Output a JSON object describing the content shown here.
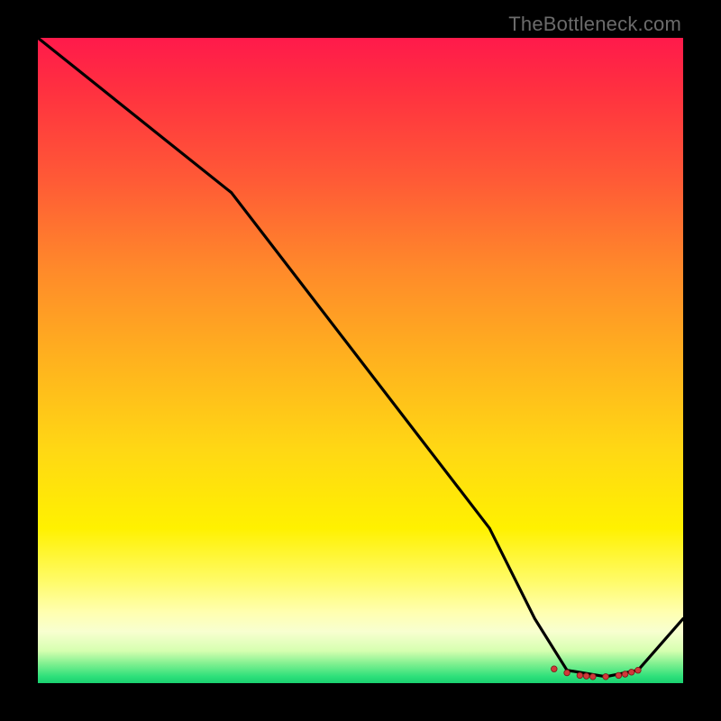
{
  "watermark": "TheBottleneck.com",
  "chart_data": {
    "type": "line",
    "title": "",
    "xlabel": "",
    "ylabel": "",
    "xlim": [
      0,
      100
    ],
    "ylim": [
      0,
      100
    ],
    "grid": false,
    "legend": false,
    "series": [
      {
        "name": "curve",
        "x": [
          0,
          10,
          20,
          30,
          40,
          50,
          60,
          70,
          77,
          82,
          88,
          93,
          100
        ],
        "y": [
          100,
          92,
          84,
          76,
          63,
          50,
          37,
          24,
          10,
          2,
          1,
          2,
          10
        ]
      }
    ],
    "markers": {
      "name": "plateau-markers",
      "x": [
        80,
        82,
        84,
        85,
        86,
        88,
        90,
        91,
        92,
        93
      ],
      "y": [
        2.2,
        1.6,
        1.2,
        1.1,
        1.0,
        1.0,
        1.2,
        1.4,
        1.7,
        2.0
      ]
    },
    "background_gradient": {
      "orientation": "vertical",
      "stops": [
        {
          "pos": 0.0,
          "color": "#ff1a4b"
        },
        {
          "pos": 0.22,
          "color": "#ff5a36"
        },
        {
          "pos": 0.5,
          "color": "#ffb21e"
        },
        {
          "pos": 0.76,
          "color": "#fff100"
        },
        {
          "pos": 0.92,
          "color": "#f8ffd0"
        },
        {
          "pos": 1.0,
          "color": "#1ad070"
        }
      ]
    }
  }
}
